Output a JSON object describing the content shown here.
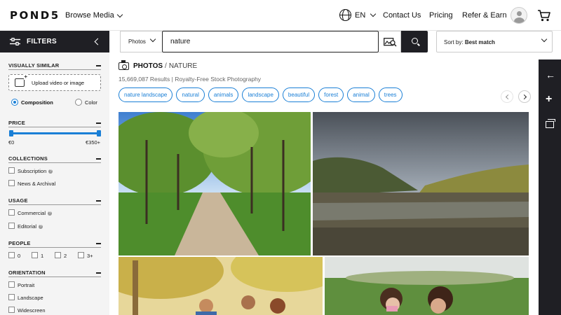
{
  "header": {
    "logo": "POND5",
    "browse_label": "Browse Media",
    "language": "EN",
    "nav": [
      "Contact Us",
      "Pricing",
      "Refer & Earn"
    ]
  },
  "search": {
    "type_label": "Photos",
    "query": "nature",
    "sort_prefix": "Sort by:",
    "sort_value": "Best match"
  },
  "filters": {
    "title": "FILTERS",
    "visually_similar": {
      "title": "VISUALLY SIMILAR",
      "upload_label": "Upload video or image",
      "modes": [
        "Composition",
        "Color"
      ],
      "selected": "Composition"
    },
    "price": {
      "title": "PRICE",
      "min": "€0",
      "max": "€350+",
      "range_fraction": [
        0,
        1
      ]
    },
    "collections": {
      "title": "COLLECTIONS",
      "items": [
        "Subscription",
        "News & Archival"
      ]
    },
    "usage": {
      "title": "USAGE",
      "items": [
        "Commercial",
        "Editorial"
      ]
    },
    "people": {
      "title": "PEOPLE",
      "items": [
        "0",
        "1",
        "2",
        "3+"
      ]
    },
    "orientation": {
      "title": "ORIENTATION",
      "items": [
        "Portrait",
        "Landscape",
        "Widescreen"
      ]
    }
  },
  "breadcrumb": {
    "category": "PHOTOS",
    "separator": "/",
    "term": "NATURE"
  },
  "results": {
    "count": "15,669,087 Results",
    "separator": "|",
    "description": "Royalty-Free Stock Photography"
  },
  "chips": [
    "nature landscape",
    "natural",
    "animals",
    "landscape",
    "beautiful",
    "forest",
    "animal",
    "trees"
  ],
  "colors": {
    "dark": "#1f1f24",
    "accent": "#1a7fd6",
    "sidebar_bg": "#f4f4f4"
  },
  "icons": [
    "globe-icon",
    "chevron-down-icon",
    "user-icon",
    "cart-icon",
    "filter-sliders-icon",
    "chevron-left-icon",
    "image-search-icon",
    "search-icon",
    "camera-icon",
    "arrow-left-icon",
    "plus-icon",
    "collection-icon",
    "upload-image-icon",
    "info-icon"
  ]
}
